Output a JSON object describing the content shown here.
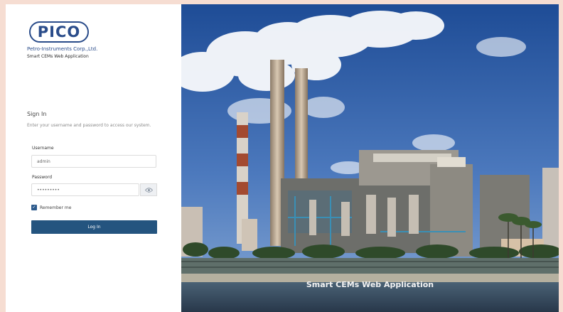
{
  "brand": {
    "logo_text": "PICO",
    "company": "Petro-Instruments Corp.,Ltd.",
    "subtitle": "Smart CEMs Web Application"
  },
  "signin": {
    "title": "Sign In",
    "description": "Enter your username and password to access our system."
  },
  "form": {
    "username_label": "Username",
    "username_value": "admin",
    "password_label": "Password",
    "password_value": "•••••••••",
    "remember_label": "Remember me",
    "remember_checked": true,
    "login_label": "Log In"
  },
  "hero": {
    "caption": "Smart CEMs Web Application"
  },
  "icons": {
    "password_toggle": "eye-icon",
    "checkbox": "checkmark-icon"
  },
  "colors": {
    "brand_blue": "#2a4c8a",
    "button": "#24547f",
    "page_bg": "#f6ddd2"
  }
}
